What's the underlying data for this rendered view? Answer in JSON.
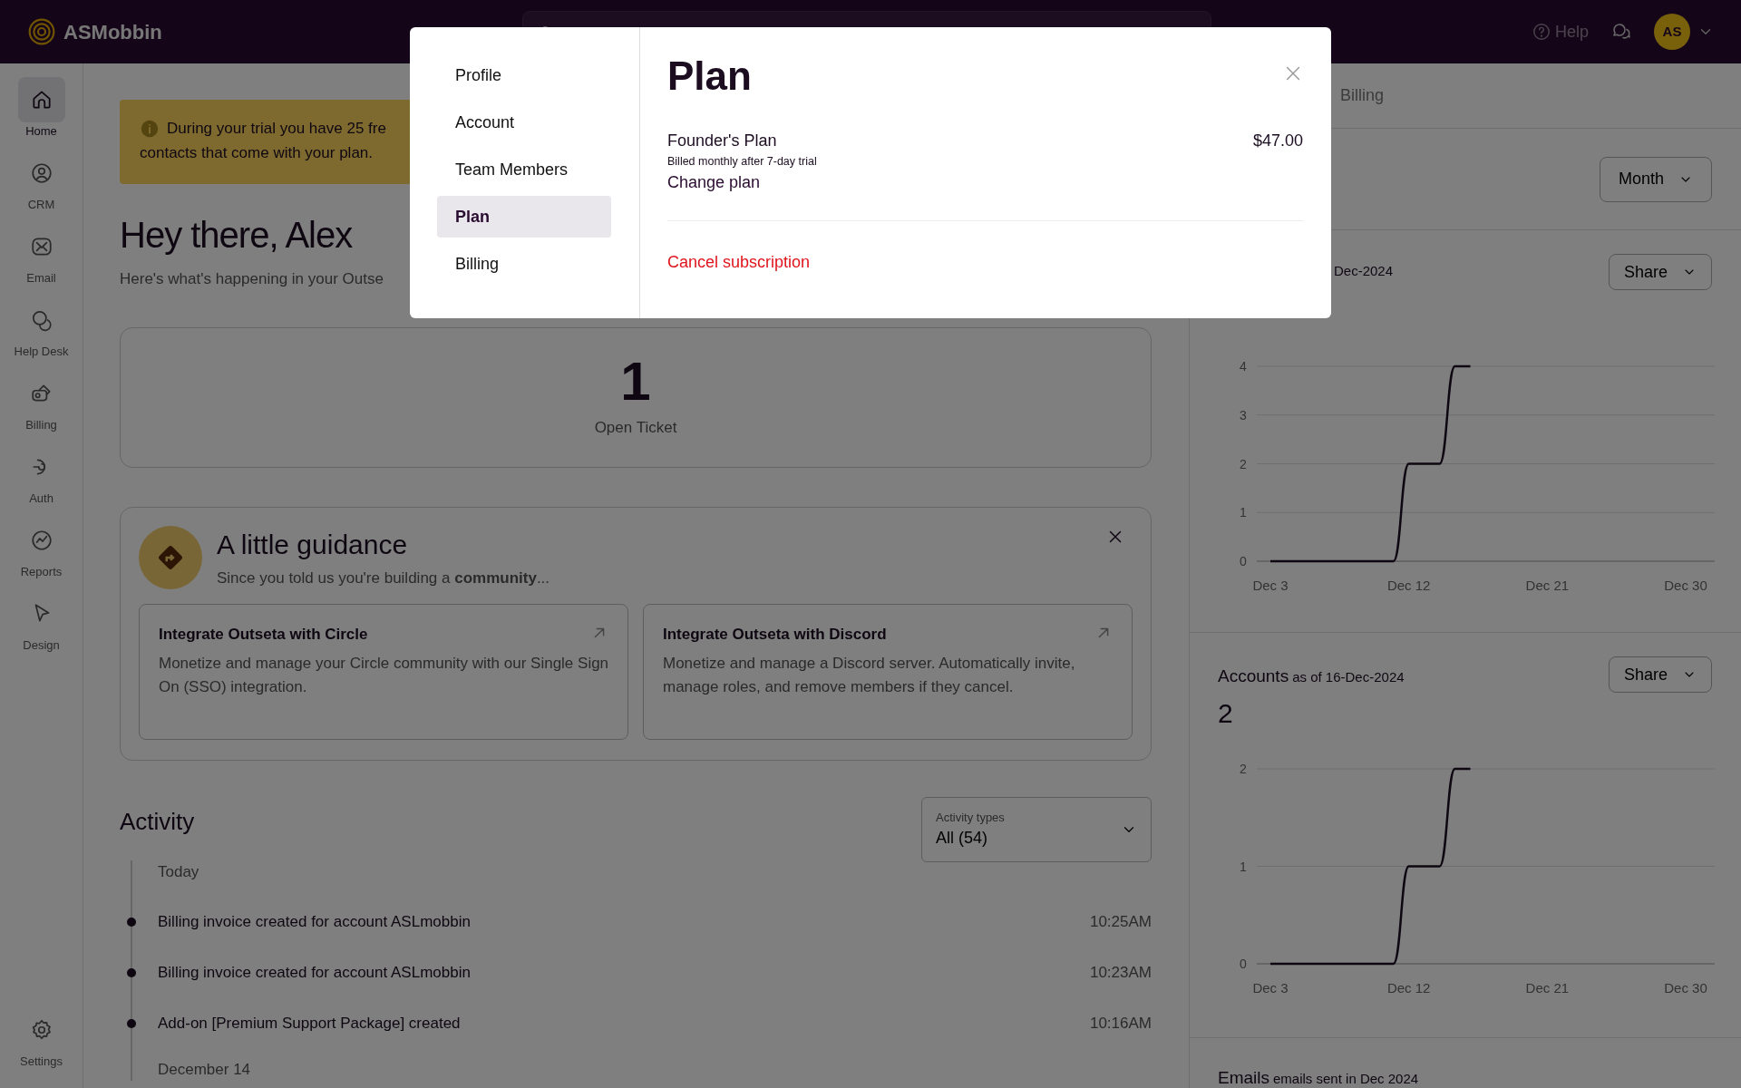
{
  "top_bar": {
    "brand": "ASMobbin",
    "help": "Help",
    "avatar": "AS"
  },
  "sidebar": {
    "items": [
      {
        "label": "Home",
        "selected": true
      },
      {
        "label": "CRM",
        "selected": false
      },
      {
        "label": "Email",
        "selected": false
      },
      {
        "label": "Help Desk",
        "selected": false
      },
      {
        "label": "Billing",
        "selected": false
      },
      {
        "label": "Auth",
        "selected": false
      },
      {
        "label": "Reports",
        "selected": false
      },
      {
        "label": "Design",
        "selected": false
      }
    ],
    "settings": "Settings"
  },
  "banner": {
    "lines": [
      "During your trial you have 25 fre",
      "contacts that come with your plan."
    ]
  },
  "greeting": {
    "title": "Hey there, Alex",
    "subtitle": "Here's what's happening in your Outse"
  },
  "ticket_card": {
    "count": "1",
    "label": "Open Ticket"
  },
  "guidance": {
    "title": "A little guidance",
    "subtitle": "Since you told us you're building a **community**...",
    "cards": [
      {
        "title": "Integrate Outseta with Circle",
        "text": "Monetize and manage your Circle community with our Single Sign On (SSO) integration."
      },
      {
        "title": "Integrate Outseta with Discord",
        "text": "Monetize and manage a Discord server. Automatically invite, manage roles, and remove members if they cancel."
      }
    ]
  },
  "activity": {
    "title": "Activity",
    "filter": {
      "label": "Activity types",
      "value": "All (54)"
    },
    "groups": [
      {
        "date": "Today",
        "items": [
          {
            "text": "Billing invoice created for account ASLmobbin",
            "time": "10:25AM"
          },
          {
            "text": "Billing invoice created for account ASLmobbin",
            "time": "10:23AM"
          },
          {
            "text": "Add-on [Premium Support Package] created",
            "time": "10:16AM"
          }
        ]
      },
      {
        "date": "December 14"
      }
    ]
  },
  "right_panel": {
    "tabs": [
      {
        "label": "Billing",
        "selected": false
      }
    ],
    "period": "Month",
    "charts": [
      {
        "subtitle": "Dec-2024",
        "share": "Share",
        "chart_data": {
          "type": "line",
          "categories": [
            "Dec 3",
            null,
            null,
            null,
            null,
            null,
            null,
            null,
            null,
            "Dec 12",
            null,
            null,
            null,
            null,
            null,
            null,
            null,
            null,
            "Dec 21",
            null,
            null,
            null,
            null,
            null,
            null,
            null,
            null,
            "Dec 30"
          ],
          "series": [
            {
              "color": "#1c0d21",
              "values": [
                0,
                0,
                0,
                0,
                0,
                0,
                0,
                0,
                0,
                2,
                2,
                2,
                4,
                4,
                null,
                null,
                null,
                null,
                null,
                null,
                null,
                null,
                null,
                null,
                null,
                null,
                null,
                null
              ]
            }
          ],
          "ylim": [
            0,
            4
          ],
          "yticks": [
            0,
            1,
            2,
            3,
            4
          ],
          "grid": true
        }
      },
      {
        "title": "Accounts",
        "subtitle": "as of 16-Dec-2024",
        "value": "2",
        "share": "Share",
        "chart_data": {
          "type": "line",
          "categories": [
            "Dec 3",
            null,
            null,
            null,
            null,
            null,
            null,
            null,
            null,
            "Dec 12",
            null,
            null,
            null,
            null,
            null,
            null,
            null,
            null,
            "Dec 21",
            null,
            null,
            null,
            null,
            null,
            null,
            null,
            null,
            "Dec 30"
          ],
          "series": [
            {
              "color": "#1c0d21",
              "values": [
                0,
                0,
                0,
                0,
                0,
                0,
                0,
                0,
                0,
                1,
                1,
                1,
                2,
                2,
                null,
                null,
                null,
                null,
                null,
                null,
                null,
                null,
                null,
                null,
                null,
                null,
                null,
                null
              ]
            }
          ],
          "ylim": [
            0,
            2
          ],
          "yticks": [
            0,
            1,
            2
          ],
          "grid": true
        }
      }
    ],
    "emails": {
      "title": "Emails",
      "subtitle": "emails sent in Dec 2024"
    }
  },
  "modal": {
    "nav": [
      {
        "label": "Profile",
        "selected": false
      },
      {
        "label": "Account",
        "selected": false
      },
      {
        "label": "Team Members",
        "selected": false
      },
      {
        "label": "Plan",
        "selected": true
      },
      {
        "label": "Billing",
        "selected": false
      }
    ],
    "title": "Plan",
    "plan": {
      "name": "Founder's Plan",
      "price": "$47.00",
      "billing": "Billed monthly after 7-day trial",
      "change": "Change plan"
    },
    "cancel": "Cancel subscription"
  }
}
